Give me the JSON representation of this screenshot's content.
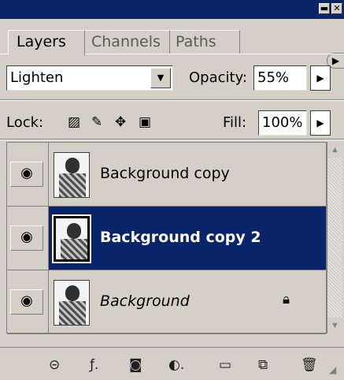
{
  "tabs": [
    {
      "label": "Layers"
    },
    {
      "label": "Channels"
    },
    {
      "label": "Paths"
    }
  ],
  "blend_mode": {
    "value": "Lighten"
  },
  "opacity": {
    "label": "Opacity:",
    "value": "55%"
  },
  "lock": {
    "label": "Lock:"
  },
  "fill": {
    "label": "Fill:",
    "value": "100%"
  },
  "layers": [
    {
      "name": "Background copy",
      "selected": false,
      "visible": true
    },
    {
      "name": "Background copy 2",
      "selected": true,
      "visible": true
    },
    {
      "name": "Background",
      "selected": false,
      "visible": true,
      "locked": true
    }
  ],
  "colors": {
    "titlebar": "#0a246a",
    "selection": "#0a246a",
    "panel": "#d4d0c8"
  }
}
